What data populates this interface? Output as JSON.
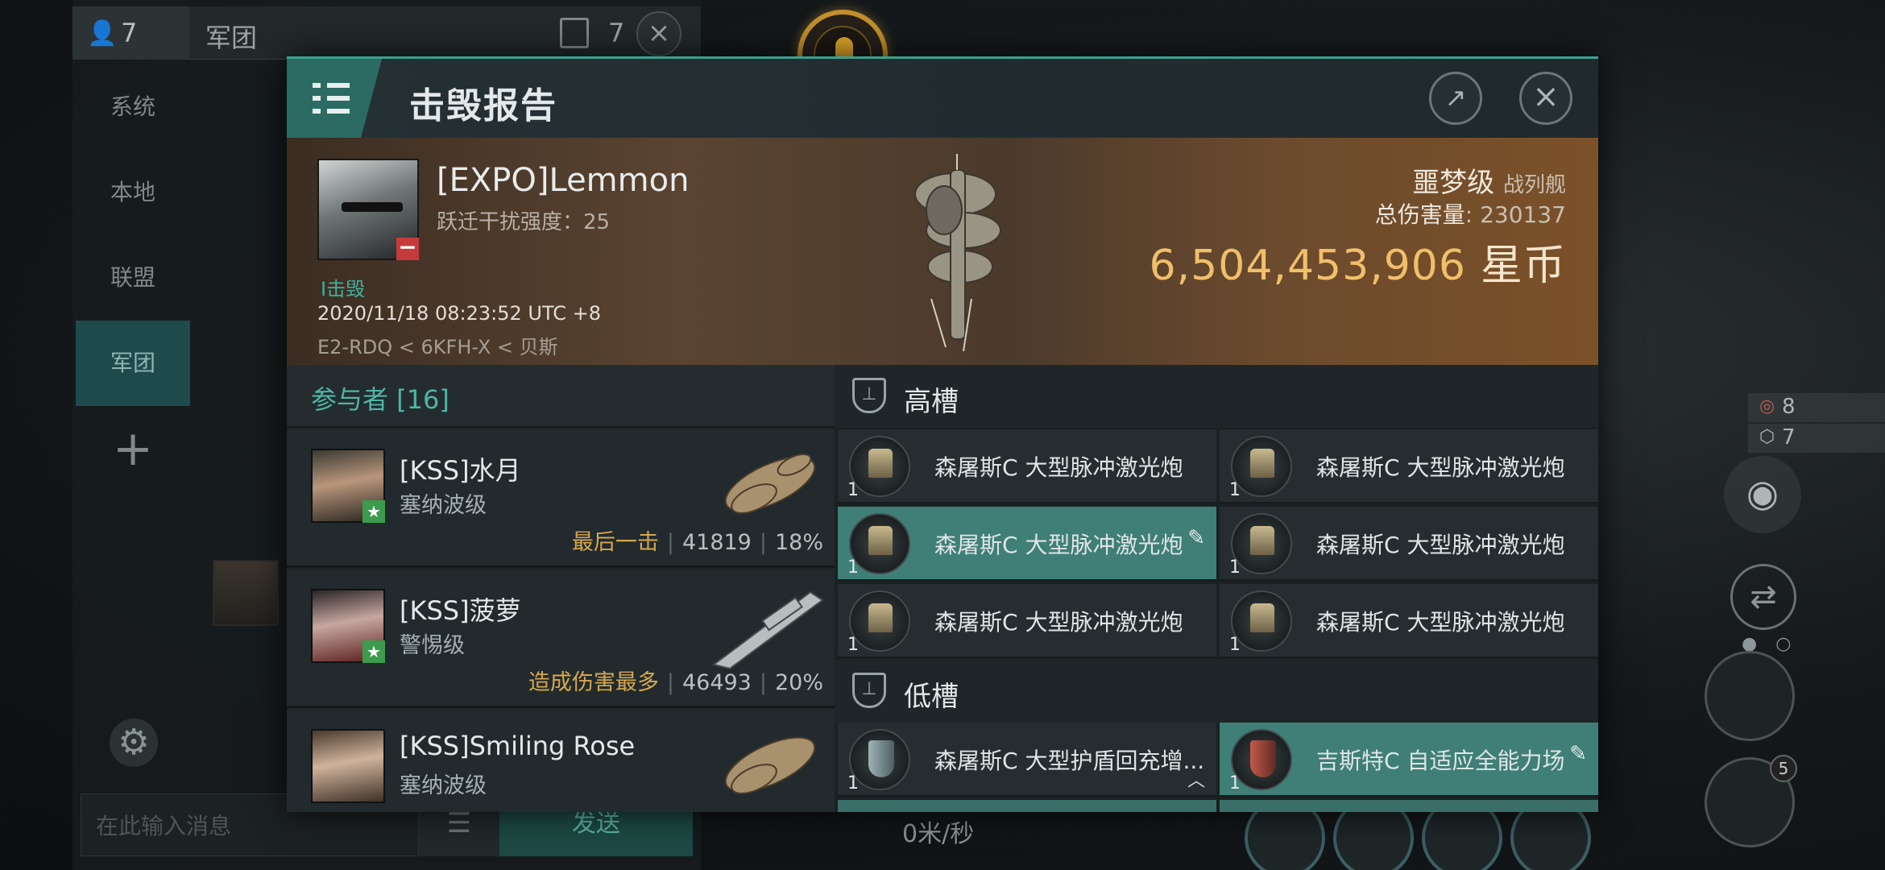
{
  "chat": {
    "member_count": "7",
    "channel_title": "军团",
    "doc_count": "7",
    "nav": [
      "系统",
      "本地",
      "联盟",
      "军团"
    ],
    "active_nav_index": 3,
    "send_label": "发送",
    "input_placeholder": "在此输入消息"
  },
  "speed_readout": "0米/秒",
  "hud": {
    "counter_a": "8",
    "counter_b": "7",
    "ship_badge": "5"
  },
  "dialog": {
    "title": "击毁报告",
    "victim": {
      "name": "[EXPO]Lemmon",
      "warp_disruption": "跃迁干扰强度：25",
      "tag": "I击毁",
      "timestamp": "2020/11/18 08:23:52 UTC +8",
      "location": "E2-RDQ < 6KFH-X < 贝斯",
      "ship_name": "噩梦级",
      "ship_type": "战列舰",
      "total_damage_label": "总伤害量",
      "total_damage_value": ": 230137",
      "isk_value": "6,504,453,906",
      "isk_unit": "星币"
    },
    "participants": {
      "header": "参与者 [16]",
      "rows": [
        {
          "name": "[KSS]水月",
          "ship": "塞纳波级",
          "tag": "最后一击",
          "damage": "41819",
          "percent": "18%"
        },
        {
          "name": "[KSS]菠萝",
          "ship": "警惕级",
          "tag": "造成伤害最多",
          "damage": "46493",
          "percent": "20%"
        },
        {
          "name": "[KSS]Smiling Rose",
          "ship": "塞纳波级",
          "tag": "",
          "damage": "",
          "percent": ""
        }
      ]
    },
    "high_slots": {
      "title": "高槽",
      "modules": [
        {
          "name": "森屠斯C 大型脉冲激光炮",
          "qty": "1"
        },
        {
          "name": "森屠斯C 大型脉冲激光炮",
          "qty": "1"
        },
        {
          "name": "森屠斯C 大型脉冲激光炮",
          "qty": "1"
        },
        {
          "name": "森屠斯C 大型脉冲激光炮",
          "qty": "1"
        },
        {
          "name": "森屠斯C 大型脉冲激光炮",
          "qty": "1"
        },
        {
          "name": "森屠斯C 大型脉冲激光炮",
          "qty": "1"
        }
      ]
    },
    "low_slots": {
      "title": "低槽",
      "modules": [
        {
          "name": "森屠斯C 大型护盾回充增...",
          "qty": "1"
        },
        {
          "name": "吉斯特C 自适应全能力场",
          "qty": "1"
        }
      ]
    }
  },
  "colors": {
    "accent_teal": "#3aa090",
    "isk_gold": "#f0bf6a",
    "selected_row": "#3f7f77",
    "highlight_tag": "#d6a84f"
  },
  "icons": [
    "person-icon",
    "document-icon",
    "close-icon",
    "plus-icon",
    "gear-icon",
    "microphone-icon",
    "menu-icon",
    "share-icon",
    "star-icon",
    "minus-icon",
    "high-slot-icon",
    "low-slot-icon",
    "eye-icon",
    "swap-icon"
  ]
}
